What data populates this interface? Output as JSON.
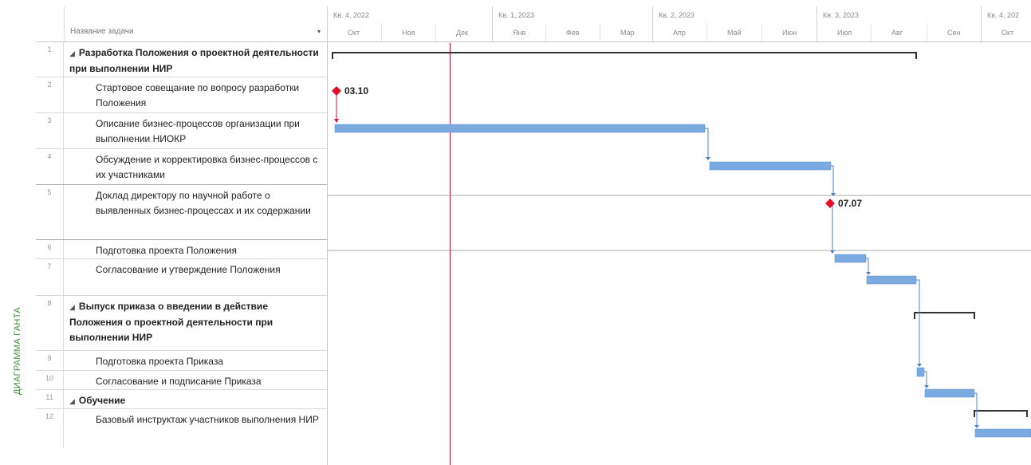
{
  "side_label": "ДИАГРАММА ГАНТА",
  "header": {
    "column_name": "Название задачи",
    "dropdown_glyph": "▾"
  },
  "timeline": {
    "quarters": [
      "Кв. 4, 2022",
      "Кв. 1, 2023",
      "Кв. 2, 2023",
      "Кв. 3, 2023",
      "Кв. 4, 202"
    ],
    "months": [
      "Окт",
      "Ноя",
      "Дек",
      "Янв",
      "Фев",
      "Мар",
      "Апр",
      "Май",
      "Июн",
      "Июл",
      "Авг",
      "Сен",
      "Окт"
    ]
  },
  "colors": {
    "bar": "#7aaadf",
    "bar_border": "#5b8fcf",
    "link": "#4f81c8",
    "milestone": "#e0102a",
    "summary": "#333333",
    "today_line": "#c8102e",
    "separator": "#a9a9a9"
  },
  "tasks": [
    {
      "id": "1",
      "name": "Разработка Положения о проектной деятельности при выполнении НИР",
      "summary": true
    },
    {
      "id": "2",
      "name": "Стартовое совещание по вопросу разработки Положения",
      "summary": false,
      "milestone_label": "03.10"
    },
    {
      "id": "3",
      "name": "Описание бизнес-процессов организации при выполнении НИОКР",
      "summary": false
    },
    {
      "id": "4",
      "name": "Обсуждение и корректировка бизнес-процессов с их участниками",
      "summary": false
    },
    {
      "id": "5",
      "name": "Доклад директору по научной работе о выявленных бизнес-процессах и их содержании",
      "summary": false,
      "milestone_label": "07.07"
    },
    {
      "id": "6",
      "name": "Подготовка проекта Положения",
      "summary": false
    },
    {
      "id": "7",
      "name": "Согласование и утверждение Положения",
      "summary": false
    },
    {
      "id": "8",
      "name": "Выпуск приказа о введении в действие Положения о проектной деятельности при выполнении НИР",
      "summary": true
    },
    {
      "id": "9",
      "name": "Подготовка проекта Приказа",
      "summary": false
    },
    {
      "id": "10",
      "name": "Согласование и подписание Приказа",
      "summary": false
    },
    {
      "id": "11",
      "name": "Обучение",
      "summary": true
    },
    {
      "id": "12",
      "name": "Базовый инструктаж участников выполнения НИР",
      "summary": false
    }
  ]
}
